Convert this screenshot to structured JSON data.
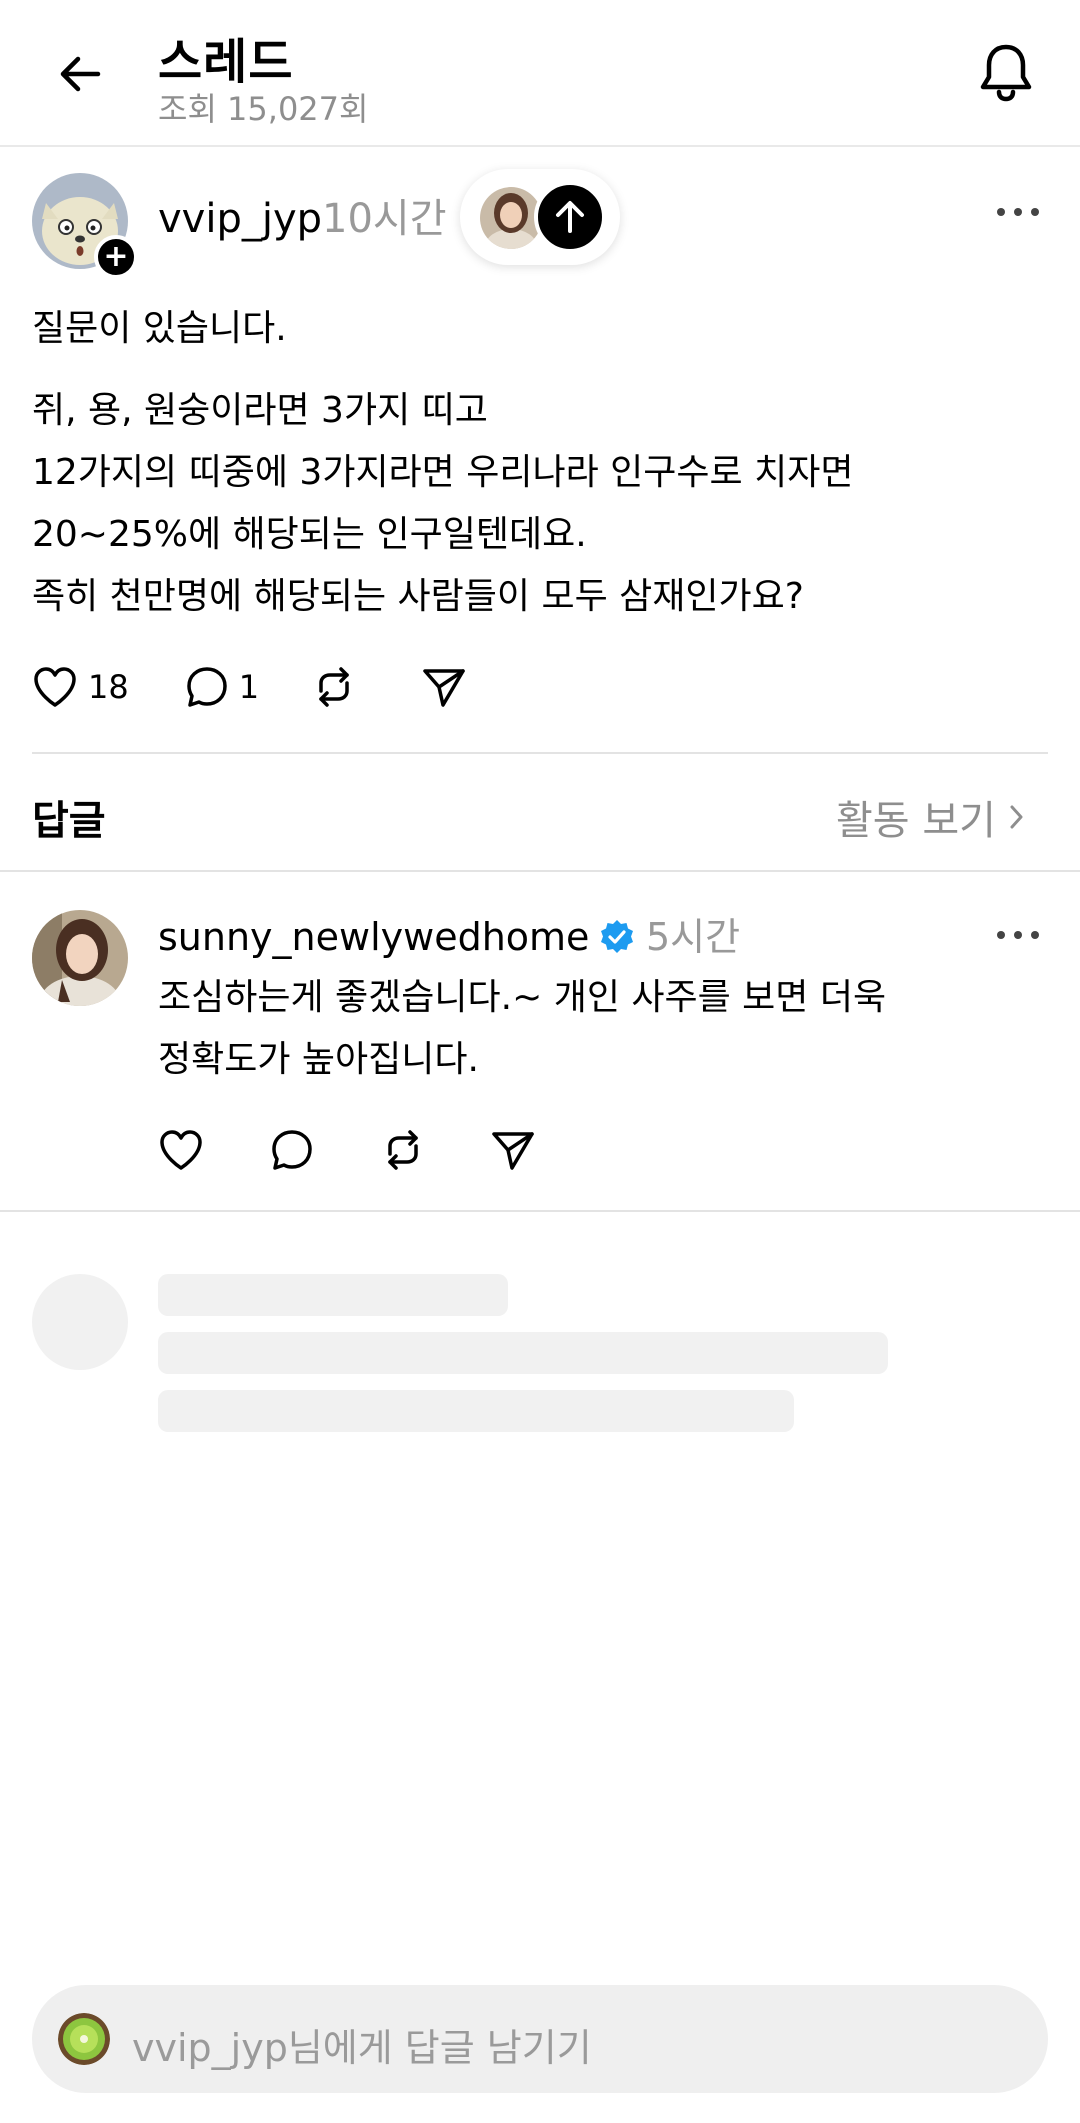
{
  "header": {
    "title": "스레드",
    "views": "조회 15,027회"
  },
  "post": {
    "username": "vvip_jyp",
    "time": "10시간",
    "lines": [
      "질문이 있습니다.",
      "쥐, 용, 원숭이라면 3가지 띠고",
      "12가지의 띠중에 3가지라면 우리나라 인구수로 치자면",
      "20~25%에 해당되는 인구일텐데요.",
      "족히 천만명에 해당되는 사람들이 모두 삼재인가요?"
    ],
    "likes": "18",
    "comments": "1"
  },
  "replies_section": {
    "label": "답글",
    "activity_link": "활동 보기"
  },
  "reply": {
    "username": "sunny_newlywedhome",
    "time": "5시간",
    "lines": [
      "조심하는게 좋겠습니다.~ 개인 사주를 보면 더욱",
      "정확도가 높아집니다."
    ]
  },
  "compose": {
    "placeholder": "vvip_jyp님에게 답글 남기기"
  },
  "icons": {
    "back": "arrow-left-icon",
    "notification": "bell-icon",
    "more": "more-horizontal-icon",
    "like": "heart-icon",
    "comment": "comment-icon",
    "repost": "repost-icon",
    "share": "send-icon",
    "verified": "verified-badge-icon",
    "follow": "plus-icon",
    "scroll_up": "arrow-up-icon",
    "chevron": "chevron-right-icon"
  },
  "colors": {
    "text": "#000000",
    "secondary": "#999999",
    "verified": "#1d9bf0",
    "divider": "#e3e3e3",
    "skeleton": "#f1f1f1",
    "compose_bg": "#efefef"
  }
}
